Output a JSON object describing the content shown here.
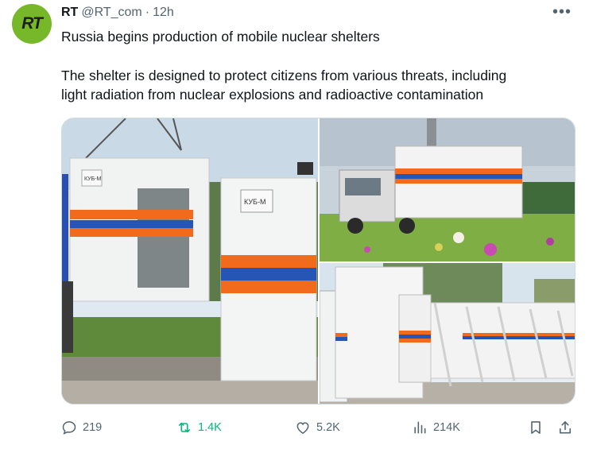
{
  "tweet": {
    "avatar_text": "RT",
    "author_name": "RT",
    "handle": "@RT_com",
    "separator": "·",
    "time": "12h",
    "more_label": "•••",
    "text_line1": "Russia begins production of mobile nuclear shelters",
    "text_line2": "The shelter is designed to protect citizens from various threats, including",
    "text_line3": "light radiation from nuclear explosions and radioactive contamination",
    "photo1_sign_left": "КУБ-М",
    "photo1_sign_right": "КУБ-М"
  },
  "actions": {
    "replies": "219",
    "reposts": "1.4K",
    "likes": "5.2K",
    "views": "214K"
  },
  "colors": {
    "avatar_bg": "#77b82a",
    "repost_active": "#00ba7c",
    "icon_gray": "#536471",
    "stripe_orange": "#f26a1b",
    "stripe_blue": "#2656b5"
  }
}
